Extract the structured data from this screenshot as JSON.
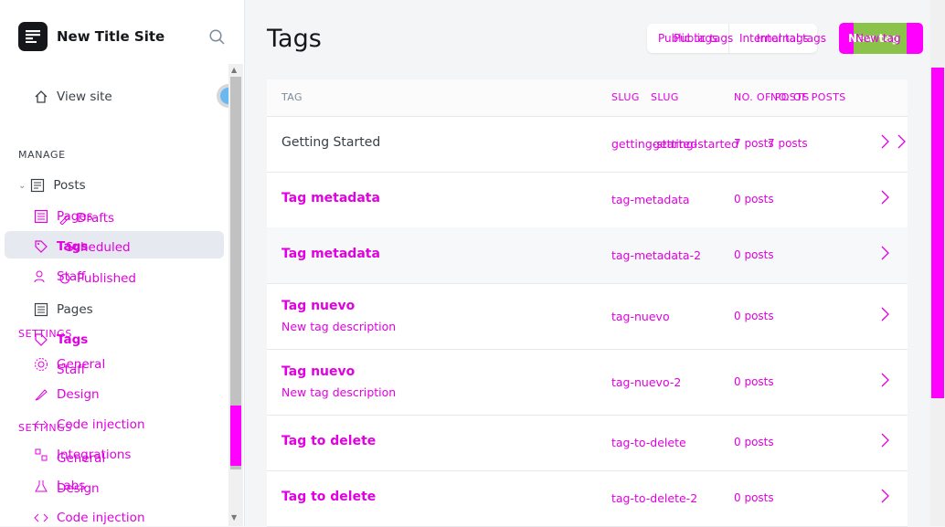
{
  "site": {
    "title": "New Title Site"
  },
  "sidebar": {
    "view_site": "View site",
    "manage_label": "MANAGE",
    "settings_label_a": "SETTINGS",
    "settings_label_b": "SETTINGS",
    "items": [
      {
        "label": "Posts",
        "icon": "posts-icon"
      },
      {
        "label": "Pages",
        "icon": "pages-icon"
      },
      {
        "label": "Drafts",
        "icon": "drafts-icon"
      },
      {
        "label": "Tags",
        "icon": "tag-icon"
      },
      {
        "label": "Scheduled",
        "icon": "scheduled-icon"
      },
      {
        "label": "Staff",
        "icon": "staff-icon"
      },
      {
        "label": "Published",
        "icon": "published-icon"
      },
      {
        "label": "Pages",
        "icon": "pages-icon"
      },
      {
        "label": "Tags",
        "icon": "tag-icon"
      },
      {
        "label": "General",
        "icon": "gear-icon"
      },
      {
        "label": "Staff",
        "icon": "staff-icon"
      },
      {
        "label": "Design",
        "icon": "brush-icon"
      },
      {
        "label": "Code injection",
        "icon": "code-icon"
      },
      {
        "label": "Integrations",
        "icon": "integrations-icon"
      },
      {
        "label": "General",
        "icon": "gear-icon"
      },
      {
        "label": "Labs",
        "icon": "labs-icon"
      },
      {
        "label": "Design",
        "icon": "brush-icon"
      },
      {
        "label": "Code injection",
        "icon": "code-icon"
      }
    ]
  },
  "header": {
    "title": "Tags",
    "tab_public_a": "Public tags",
    "tab_public_b": "Public tags",
    "tab_internal_a": "Internal tags",
    "tab_internal_b": "Internal tags",
    "new_tag_a": "New tag",
    "new_tag_b": "New tag"
  },
  "table": {
    "col_tag": "TAG",
    "col_slug_a": "SLUG",
    "col_slug_b": "SLUG",
    "col_posts_a": "NO. OF POSTS",
    "col_posts_b": "NO. OF POSTS",
    "rows": [
      {
        "name": "Getting Started",
        "desc": "",
        "slug": "getting-started",
        "posts": "7 posts"
      },
      {
        "name": "Tag metadata",
        "desc": "",
        "slug": "tag-metadata",
        "posts": "0 posts"
      },
      {
        "name": "Tag metadata",
        "desc": "",
        "slug": "tag-metadata-2",
        "posts": "0 posts"
      },
      {
        "name": "Tag nuevo",
        "desc": "New tag description",
        "slug": "tag-nuevo",
        "posts": "0 posts"
      },
      {
        "name": "Tag nuevo",
        "desc": "New tag description",
        "slug": "tag-nuevo-2",
        "posts": "0 posts"
      },
      {
        "name": "Tag to delete",
        "desc": "",
        "slug": "tag-to-delete",
        "posts": "0 posts"
      },
      {
        "name": "Tag to delete",
        "desc": "",
        "slug": "tag-to-delete-2",
        "posts": "0 posts"
      }
    ]
  },
  "colors": {
    "accent": "#e100e1",
    "overlay": "#ff00ff",
    "button_green": "#8bc34a",
    "text": "#15171a"
  }
}
